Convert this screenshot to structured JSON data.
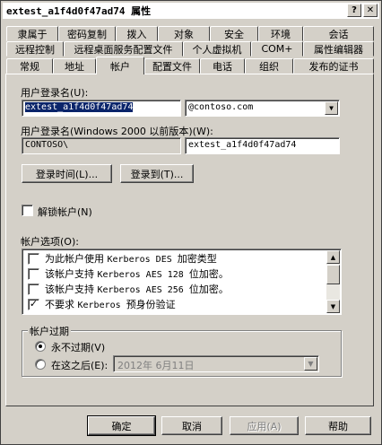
{
  "window": {
    "title_code": "extest_a1f4d0f47ad74",
    "title_suffix": "属性",
    "help_glyph": "?",
    "close_glyph": "✕"
  },
  "tabs": {
    "row1": [
      "隶属于",
      "密码复制",
      "拨入",
      "对象",
      "安全",
      "环境",
      "会话"
    ],
    "row2": [
      "远程控制",
      "远程桌面服务配置文件",
      "个人虚拟机",
      "COM+",
      "属性编辑器"
    ],
    "row3": [
      "常规",
      "地址",
      "帐户",
      "配置文件",
      "电话",
      "组织",
      "发布的证书"
    ],
    "active": "帐户"
  },
  "account": {
    "logon_name_label": "用户登录名(U):",
    "logon_name_value": "extest_a1f4d0f47ad74",
    "domain_value": "@contoso.com",
    "pre2000_label": "用户登录名(Windows 2000 以前版本)(W):",
    "pre2000_domain": "CONTOSO\\",
    "pre2000_value": "extest_a1f4d0f47ad74",
    "logon_hours_button": "登录时间(L)...",
    "logon_to_button": "登录到(T)...",
    "unlock_label": "解锁帐户(N)",
    "options_label": "帐户选项(O):",
    "options": [
      {
        "prefix": "为此帐户使用 ",
        "mono": "Kerberos DES ",
        "suffix": "加密类型",
        "checked": false
      },
      {
        "prefix": "该帐户支持 ",
        "mono": "Kerberos AES 128 ",
        "suffix": "位加密。",
        "checked": false
      },
      {
        "prefix": "该帐户支持 ",
        "mono": "Kerberos AES 256 ",
        "suffix": "位加密。",
        "checked": false
      },
      {
        "prefix": "不要求 ",
        "mono": "Kerberos ",
        "suffix": "预身份验证",
        "checked": true
      }
    ],
    "expiry": {
      "legend": "帐户过期",
      "never_label": "永不过期(V)",
      "end_of_label": "在这之后(E):",
      "date_value": "2012年  6月11日",
      "selected": "never"
    }
  },
  "footer": {
    "ok": "确定",
    "cancel": "取消",
    "apply": "应用(A)",
    "help": "帮助"
  }
}
